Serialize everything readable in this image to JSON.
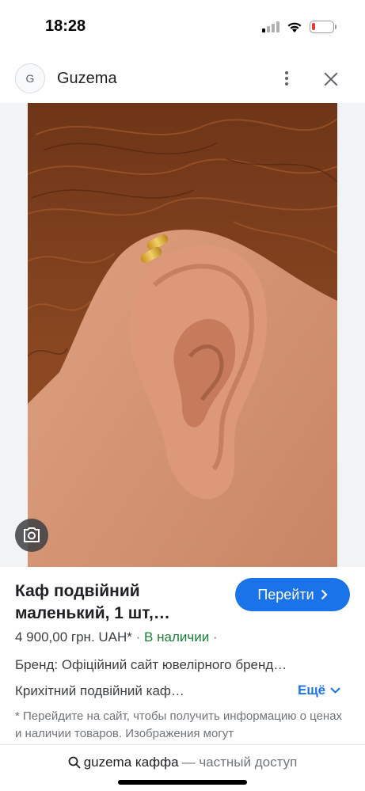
{
  "status_bar": {
    "time": "18:28",
    "battery_level": 0.15,
    "icons": [
      "signal-icon",
      "wifi-icon",
      "battery-icon"
    ],
    "battery_color": "#e53935"
  },
  "header": {
    "site_icon_letter": "G",
    "site_name": "Guzema",
    "icons": [
      "more-vert-icon",
      "close-icon"
    ]
  },
  "product": {
    "title": "Каф подвійний маленький, 1 шт,…",
    "visit_button": "Перейти",
    "price": "4 900,00 грн. UAH*",
    "separator": "·",
    "stock": "В наличии",
    "brand": "Бренд: Офіційний сайт ювелірного бренд…",
    "description": "Крихітний подвійний каф…",
    "more_link": "Ещё",
    "disclaimer": "* Перейдите на сайт, чтобы получить информацию о ценах и наличии товаров. Изображения могут",
    "colors": {
      "accent": "#1a73e8",
      "stock": "#188038"
    }
  },
  "bottom_bar": {
    "query": "guzema каффа",
    "private_label": "— частный доступ"
  }
}
